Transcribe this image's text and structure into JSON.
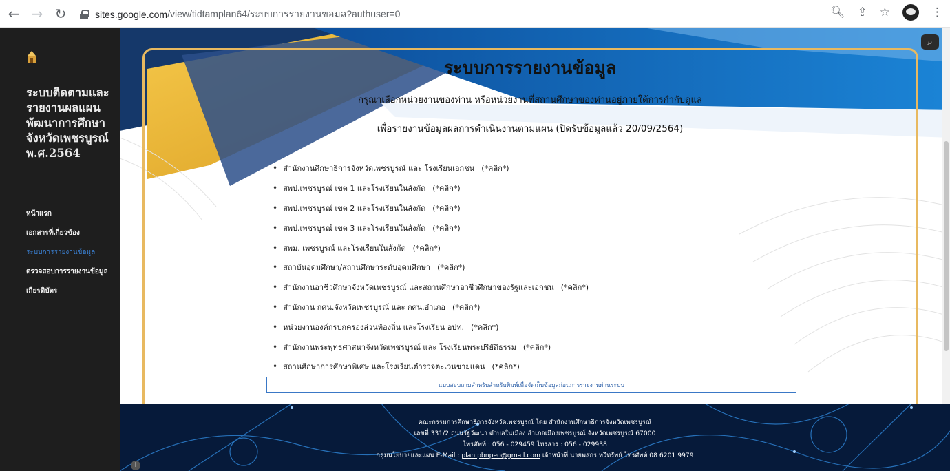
{
  "browser": {
    "url_host": "sites.google.com",
    "url_path": "/view/tidtamplan64/ระบบการรายงานขอมล?authuser=0"
  },
  "sidebar": {
    "title": "ระบบติดตามและรายงานผลแผนพัฒนาการศึกษาจังหวัดเพชรบูรณ์ พ.ศ.2564",
    "nav": [
      {
        "label": "หน้าแรก",
        "active": false
      },
      {
        "label": "เอกสารที่เกี่ยวข้อง",
        "active": false
      },
      {
        "label": "ระบบการรายงานข้อมูล",
        "active": true
      },
      {
        "label": "ตรวจสอบการรายงานข้อมูล",
        "active": false
      },
      {
        "label": "เกียรติบัตร",
        "active": false
      }
    ]
  },
  "main": {
    "heading": "ระบบการรายงานข้อมูล",
    "subtitle_1": "กรุณาเลือกหน่วยงานของท่าน หรือหน่วยงานที่สถานศึกษาของท่านอยู่ภายใต้การกำกับดูแล",
    "subtitle_2": "เพื่อรายงานข้อมูลผลการดำเนินงานตามแผน (ปิดรับข้อมูลแล้ว 20/09/2564)",
    "agencies": [
      {
        "label": "สำนักงานศึกษาธิการจังหวัดเพชรบูรณ์ และ โรงเรียนเอกชน",
        "link": "(*คลิก*)"
      },
      {
        "label": "สพป.เพชรบูรณ์ เขต 1 และโรงเรียนในสังกัด",
        "link": "(*คลิก*)"
      },
      {
        "label": "สพป.เพชรบูรณ์ เขต 2  และโรงเรียนในสังกัด",
        "link": "(*คลิก*)"
      },
      {
        "label": "สพป.เพชรบูรณ์ เขต 3 และโรงเรียนในสังกัด",
        "link": "(*คลิก*)"
      },
      {
        "label": "สพม. เพชรบูรณ์  และโรงเรียนในสังกัด",
        "link": "(*คลิก*)"
      },
      {
        "label": "สถาบันอุดมศึกษา/สถานศึกษาระดับอุดมศึกษา",
        "link": "(*คลิก*)"
      },
      {
        "label": "สำนักงานอาชีวศึกษาจังหวัดเพชรบูรณ์ และสถานศึกษาอาชีวศึกษาของรัฐและเอกชน",
        "link": "(*คลิก*)"
      },
      {
        "label": "สำนักงาน กศน.จังหวัดเพชรบูรณ์ และ กศน.อำเภอ",
        "link": "(*คลิก*)"
      },
      {
        "label": "หน่วยงานองค์กรปกครองส่วนท้องถิ่น และโรงเรียน อปท.",
        "link": "(*คลิก*)"
      },
      {
        "label": "สำนักงานพระพุทธศาสนาจังหวัดเพชรบูรณ์ และ โรงเรียนพระปริยัติธรรม",
        "link": "(*คลิก*)"
      },
      {
        "label": "สถานศึกษาการศึกษาพิเศษ และโรงเรียนตำรวจตะเวนชายแดน",
        "link": "(*คลิก*)"
      }
    ],
    "survey_button": "แบบสอบถามสำหรับสำหรับพิมพ์เพื่อจัดเก็บข้อมูลก่อนการรายงานผ่านระบบ"
  },
  "footer": {
    "line_1": "คณะกรรมการศึกษาธิการจังหวัดเพชรบูรณ์  โดย สำนักงานศึกษาธิการจังหวัดเพชรบูรณ์",
    "line_2": "เลขที่ 331/2 ถนนรัฐวัฒนา ตำบลในเมือง อำเภอเมืองเพชรบูรณ์ จังหวัดเพชรบูรณ์ 67000",
    "line_3": "โทรศัพท์ : 056 - 029459  โทรสาร : 056 - 029938",
    "line_4_prefix": "กลุ่มนโยบายและแผน E-Mail : ",
    "email": "plan.pbnpeo@gmail.com",
    "line_4_suffix": "  เจ้าหน้าที่ นายพสกร ทวีทรัพย์ โทรศัพท์ 08 6201 9979"
  },
  "colors": {
    "accent_frame": "#e8b960",
    "sidebar_bg": "#1e1e1e",
    "active_link": "#3b82d6",
    "footer_bg": "#061a3a"
  }
}
